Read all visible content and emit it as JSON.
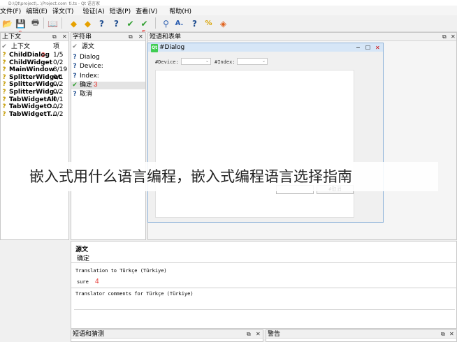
{
  "window": {
    "title": "D:\\Qt\\project\\...\\Project.com_ti.ts - Qt 语言家"
  },
  "menu": [
    "文件(F)",
    "编辑(E)",
    "译文(T)",
    "验证(A)",
    "短语(P)",
    "查看(V)",
    "帮助(H)"
  ],
  "toolbar": {
    "icons": [
      "open-icon",
      "save-icon",
      "print-icon",
      "phrasebook-icon",
      "prev-icon",
      "next-icon",
      "prev-unfinished-icon",
      "next-unfinished-icon",
      "done-next-icon",
      "done-icon",
      "search-icon",
      "accelerator-icon",
      "punctuation-icon",
      "phrase-match-icon",
      "placeholder-icon"
    ]
  },
  "marks": {
    "m1": "1",
    "m2": "2",
    "m3": "3",
    "m4": "4",
    "m5": "5",
    "m6": "6"
  },
  "context_panel": {
    "title": "上下文",
    "col_context": "上下文",
    "col_items": "项",
    "rows": [
      {
        "name": "ChildDialog",
        "count": "1/5"
      },
      {
        "name": "ChildWidget",
        "count": "0/2"
      },
      {
        "name": "MainWindow",
        "count": "8/19"
      },
      {
        "name": "SplitterWidget",
        "count": "0/1"
      },
      {
        "name": "SplitterWidg...",
        "count": "0/2"
      },
      {
        "name": "SplitterWidg...",
        "count": "0/2"
      },
      {
        "name": "TabWidgetAll",
        "count": "0/1"
      },
      {
        "name": "TabWidgetO...",
        "count": "0/2"
      },
      {
        "name": "TabWidgetT...",
        "count": "0/2"
      }
    ]
  },
  "strings_panel": {
    "title": "字符串",
    "col_source": "源文",
    "rows": [
      "Dialog",
      "Device:",
      "Index:",
      "确定",
      "取消"
    ]
  },
  "form_panel": {
    "title": "短语和表单",
    "dialog_title": "#Dialog",
    "qt_badge": "Qt",
    "device_label": "#Device:",
    "index_label": "#Index:",
    "cancel_label": "#取消"
  },
  "editor": {
    "source_label": "源文",
    "source_text": "确定",
    "translation_label": "Translation to Türkçe (Türkiye)",
    "translation_text": "sure",
    "comments_label": "Translator comments for Türkçe (Türkiye)"
  },
  "bottom": {
    "phrases_title": "短语和猜测",
    "warnings_title": "警告"
  },
  "overlay_text": "嵌入式用什么语言编程，嵌入式编程语言选择指南"
}
